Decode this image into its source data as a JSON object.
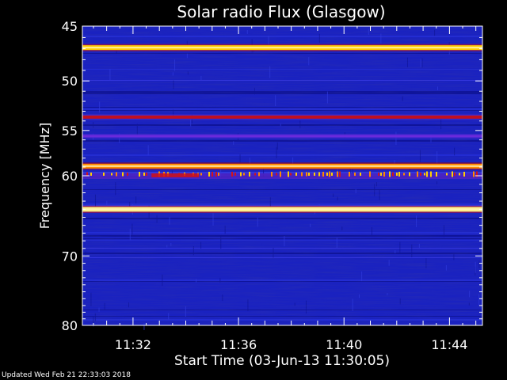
{
  "footer": "Updated Wed Feb 21 22:33:03 2018",
  "chart_data": {
    "type": "heatmap",
    "title": "Solar radio Flux (Glasgow)",
    "xlabel": "Start Time (03-Jun-13 11:30:05)",
    "ylabel": "Frequency [MHz]",
    "x_ticks": [
      "11:32",
      "11:36",
      "11:40",
      "11:44"
    ],
    "x_tick_minutes": [
      32,
      36,
      40,
      44
    ],
    "xlim_minutes": [
      30.08,
      45.25
    ],
    "y_ticks": [
      45,
      50,
      55,
      60,
      70,
      80
    ],
    "ylim_mhz": [
      45,
      80
    ],
    "y_scale": "log",
    "background_color": "#1a22c0",
    "colormap": [
      "#000060",
      "#1a22c0",
      "#6a2adc",
      "#c01020",
      "#ff6a00",
      "#ffcc00",
      "#ffffd0"
    ],
    "continuous_bands": [
      {
        "freq": 46.9,
        "intensity": "high",
        "color": "#ffcc00"
      },
      {
        "freq": 53.6,
        "intensity": "medium",
        "color": "#c01020"
      },
      {
        "freq": 55.6,
        "intensity": "low",
        "color": "#6a2adc"
      },
      {
        "freq": 58.9,
        "intensity": "high",
        "color": "#ff8c00"
      },
      {
        "freq": 64.0,
        "intensity": "high",
        "color": "#ffee80"
      }
    ],
    "burst_band": {
      "freq": 60.0,
      "color": "#ff9000"
    }
  }
}
